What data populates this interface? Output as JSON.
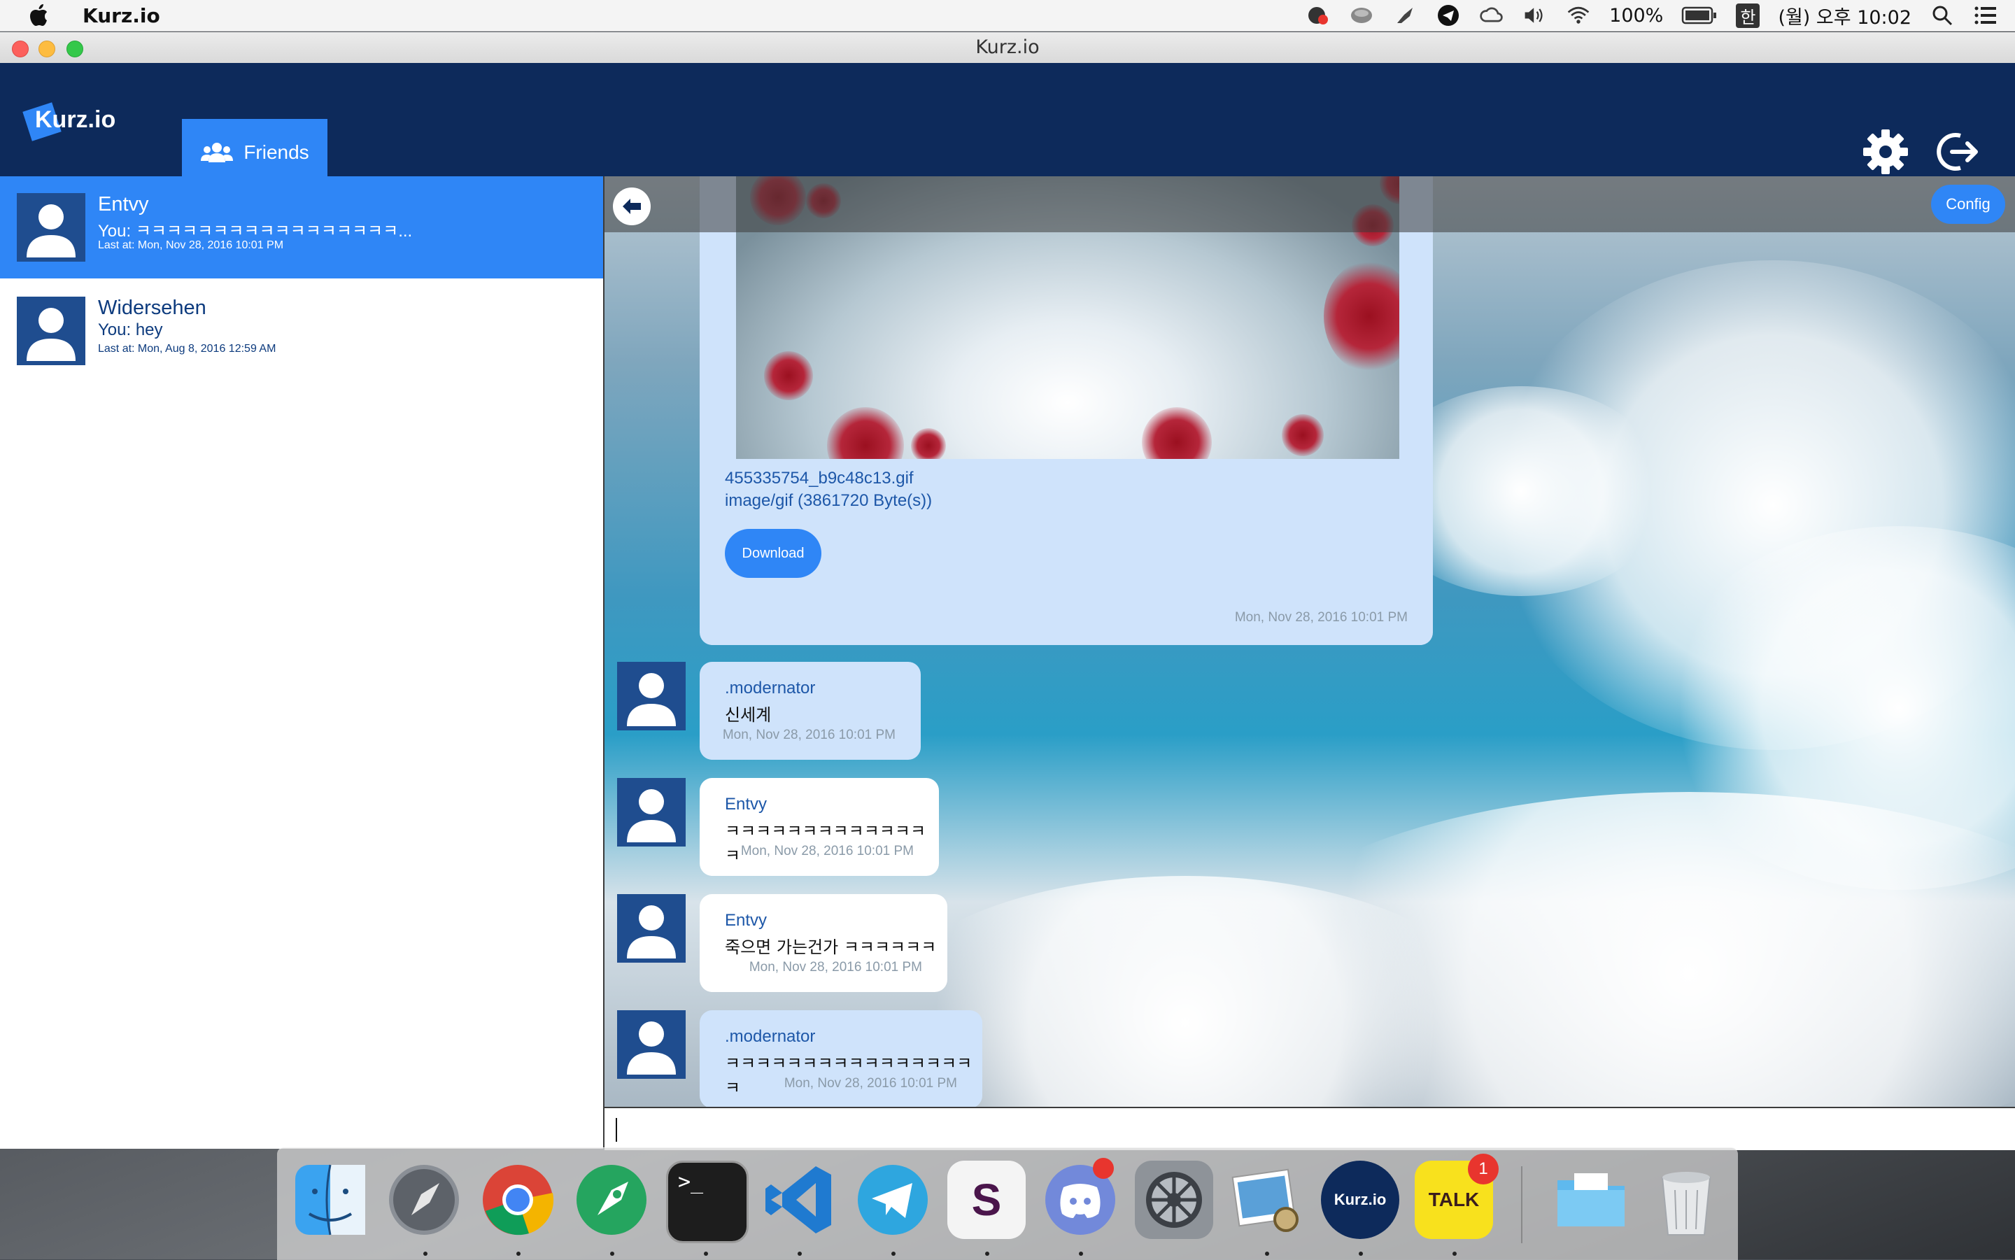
{
  "menubar": {
    "app_name": "Kurz.io",
    "battery": "100%",
    "input_source": "한",
    "clock": "(월) 오후 10:02"
  },
  "window": {
    "title": "Kurz.io"
  },
  "header": {
    "logo_text": "Kurz.io",
    "friends_label": "Friends"
  },
  "friends": [
    {
      "name": "Entvy",
      "preview": "You: ㅋㅋㅋㅋㅋㅋㅋㅋㅋㅋㅋㅋㅋㅋㅋㅋㅋ...",
      "last": "Last at: Mon, Nov 28, 2016 10:01 PM"
    },
    {
      "name": "Widersehen",
      "preview": "You: hey",
      "last": "Last at: Mon, Aug 8, 2016 12:59 AM"
    }
  ],
  "chat": {
    "config_label": "Config",
    "attachment": {
      "file_name": "455335754_b9c48c13.gif",
      "file_type": "image/gif (3861720 Byte(s))",
      "download_label": "Download",
      "time": "Mon, Nov 28, 2016 10:01 PM"
    },
    "messages": [
      {
        "author": ".modernator",
        "text": "신세계",
        "time": "Mon, Nov 28, 2016 10:01 PM"
      },
      {
        "author": "Entvy",
        "text": "ㅋㅋㅋㅋㅋㅋㅋㅋㅋㅋㅋㅋㅋㅋ",
        "time": "Mon, Nov 28, 2016 10:01 PM"
      },
      {
        "author": "Entvy",
        "text": "죽으면 가는건가 ㅋㅋㅋㅋㅋㅋ",
        "time": "Mon, Nov 28, 2016 10:01 PM"
      },
      {
        "author": ".modernator",
        "text": "ㅋㅋㅋㅋㅋㅋㅋㅋㅋㅋㅋㅋㅋㅋㅋㅋㅋ",
        "time": "Mon, Nov 28, 2016 10:01 PM"
      }
    ]
  },
  "dock": {
    "items": [
      {
        "icon": "finder-icon"
      },
      {
        "icon": "launchpad-icon"
      },
      {
        "icon": "chrome-icon"
      },
      {
        "icon": "rocket-app-icon"
      },
      {
        "icon": "terminal-icon",
        "glyph": ">_"
      },
      {
        "icon": "vscode-icon"
      },
      {
        "icon": "telegram-icon"
      },
      {
        "icon": "slack-icon",
        "glyph": "S"
      },
      {
        "icon": "discord-icon"
      },
      {
        "icon": "system-preferences-icon"
      },
      {
        "icon": "preview-icon"
      },
      {
        "icon": "kurzio-icon",
        "glyph": "Kurz.io"
      },
      {
        "icon": "kakaotalk-icon",
        "glyph": "TALK"
      },
      {
        "icon": "folder-icon"
      },
      {
        "icon": "trash-icon"
      }
    ],
    "badges": {
      "kakaotalk": "1"
    }
  },
  "colors": {
    "header_bg": "#0d2a5b",
    "accent": "#2f86f6",
    "bubble_mod": "#cfe3fb",
    "bubble_me": "#ffffff",
    "author_text": "#1d57a8"
  }
}
